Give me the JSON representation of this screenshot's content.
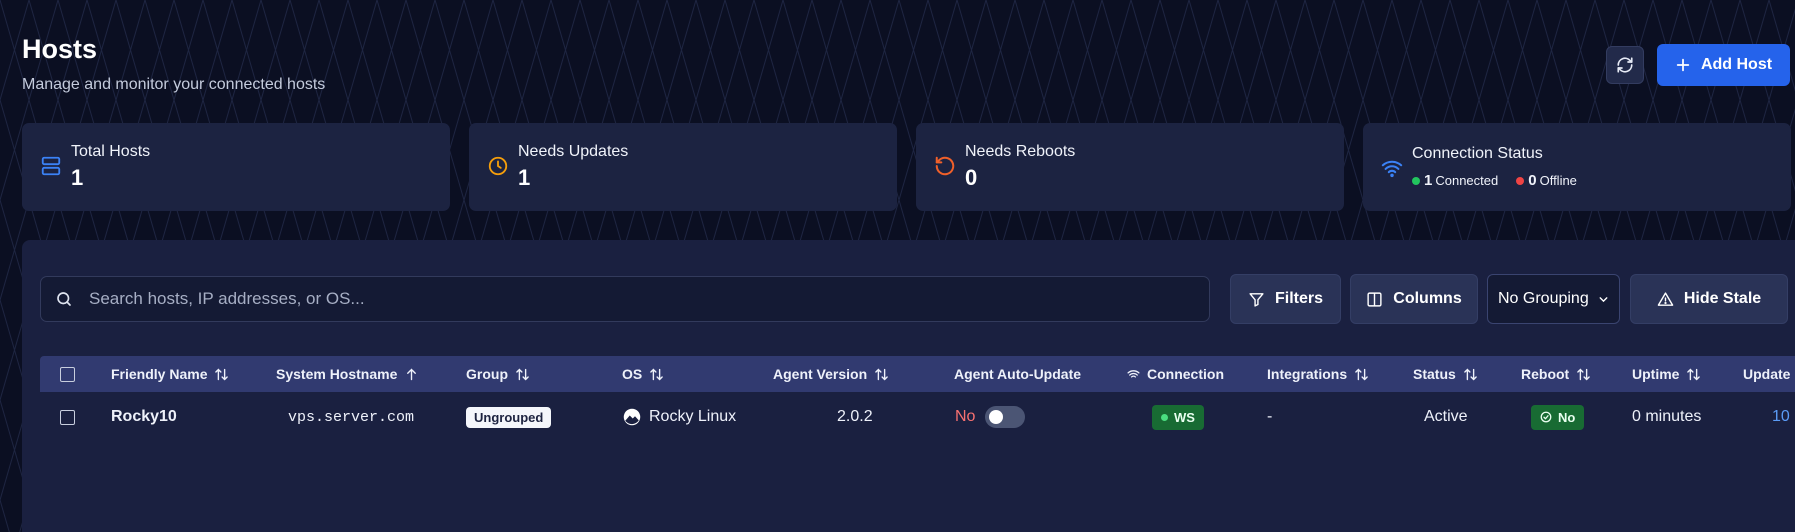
{
  "header": {
    "title": "Hosts",
    "subtitle": "Manage and monitor your connected hosts",
    "add_host_label": "Add Host"
  },
  "stats": [
    {
      "label": "Total Hosts",
      "value": "1",
      "icon": "server-icon",
      "color": "#3b82f6"
    },
    {
      "label": "Needs Updates",
      "value": "1",
      "icon": "clock-icon",
      "color": "#f59e0b"
    },
    {
      "label": "Needs Reboots",
      "value": "0",
      "icon": "rotate-icon",
      "color": "#f0602a"
    },
    {
      "label": "Connection Status",
      "icon": "wifi-icon",
      "color": "#3b82f6"
    }
  ],
  "connection": {
    "connected_count": "1",
    "connected_label": "Connected",
    "connected_color": "#22c55e",
    "offline_count": "0",
    "offline_label": "Offline",
    "offline_color": "#ef4444"
  },
  "toolbar": {
    "search_placeholder": "Search hosts, IP addresses, or OS...",
    "filters_label": "Filters",
    "columns_label": "Columns",
    "grouping_value": "No Grouping",
    "hide_stale_label": "Hide Stale"
  },
  "table": {
    "columns": [
      "Friendly Name",
      "System Hostname",
      "Group",
      "OS",
      "Agent Version",
      "Agent Auto-Update",
      "Connection",
      "Integrations",
      "Status",
      "Reboot",
      "Uptime",
      "Update"
    ],
    "rows": [
      {
        "friendly_name": "Rocky10",
        "hostname": "vps.server.com",
        "group": "Ungrouped",
        "os": "Rocky Linux",
        "agent_version": "2.0.2",
        "auto_update": "No",
        "auto_update_on": false,
        "connection": "WS",
        "integrations": "-",
        "status": "Active",
        "reboot": "No",
        "uptime": "0 minutes",
        "update_partial": "10"
      }
    ]
  },
  "colors": {
    "accent": "#2563eb",
    "danger_text": "#f87171",
    "link": "#5b9bf5"
  }
}
